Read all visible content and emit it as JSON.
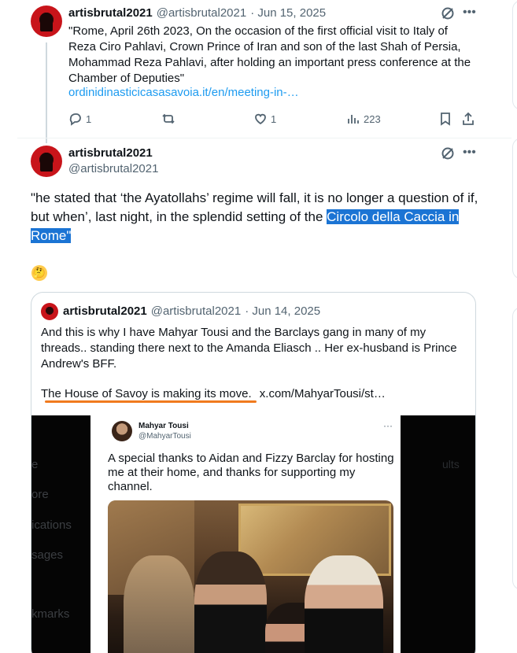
{
  "tweet1": {
    "display_name": "artisbrutal2021",
    "handle": "@artisbrutal2021",
    "date": "· Jun 15, 2025",
    "text": "\"Rome, April 26th 2023, On the occasion of the first official visit to  Italy of Reza Ciro Pahlavi, Crown Prince of Iran and son of the last  Shah of Persia, Mohammad Reza Pahlavi, after holding an important press  conference at the Chamber of Deputies\"",
    "link": "ordinidinasticicasasavoia.it/en/meeting-in-…",
    "replies": "1",
    "likes": "1",
    "views": "223"
  },
  "tweet2": {
    "display_name": "artisbrutal2021",
    "handle": "@artisbrutal2021",
    "text_before": "\"he stated that ‘the Ayatollahs’ regime will fall, it is no longer a  question of if, but when’, last night, in the splendid setting of the ",
    "text_selected": "Circolo della Caccia in Rome\"",
    "emoji": "🤔"
  },
  "quote": {
    "display_name": "artisbrutal2021",
    "handle": "@artisbrutal2021",
    "date": "· Jun 14, 2025",
    "text": "And this is why I have Mahyar Tousi and the Barclays gang in many of my threads.. standing there next to the Amanda Eliasch .. Her ex-husband is Prince Andrew's BFF.",
    "highlight_text": "The House of Savoy is making its move. ",
    "link": "x.com/MahyarTousi/st…"
  },
  "embed": {
    "name": "Mahyar Tousi",
    "handle": "@MahyarTousi",
    "more": "···",
    "text": "A special thanks to Aidan and Fizzy Barclay for hosting me at their home, and thanks for supporting my channel."
  },
  "ghost_nav": [
    "e",
    "ore",
    "ications",
    "sages",
    "kmarks"
  ],
  "ghost_right": "ults",
  "colors": {
    "link": "#1d9bf0",
    "selection": "#1b74d4",
    "underline": "#f07a1e",
    "muted": "#536471"
  }
}
